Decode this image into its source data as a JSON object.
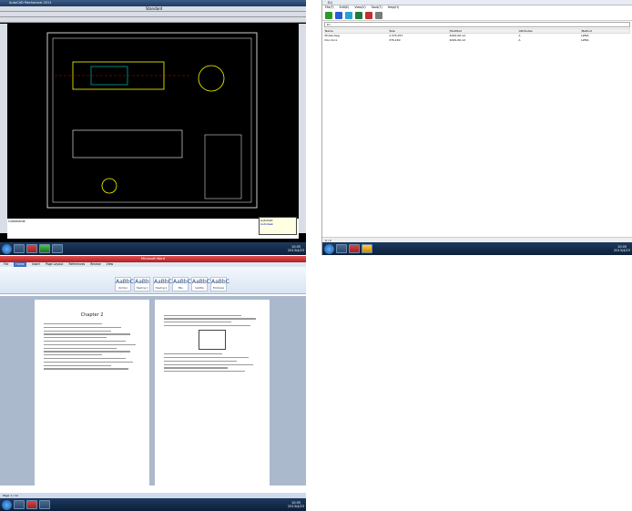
{
  "cad": {
    "title_left": "AutoCAD",
    "title_right": "Mechanical 2011",
    "layer": "Standard",
    "command_line": "Command:",
    "balloon_title": "AutoCAD",
    "balloon_link": "Autodesk"
  },
  "file_manager": {
    "title": "D:\\",
    "menu": [
      "File(F)",
      "Edit(E)",
      "View(V)",
      "Tools(T)",
      "Help(H)"
    ],
    "columns": [
      "Name",
      "Size",
      "Modified",
      "Attributes",
      "Method"
    ],
    "files": [
      {
        "name": "Model.dwg",
        "size": "1,375,257",
        "date": "2009-06-12",
        "attr": "A",
        "method": "LZMA"
      },
      {
        "name": "Doc.docx",
        "size": "376,160",
        "date": "2009-06-12",
        "attr": "A",
        "method": "LZMA"
      }
    ],
    "status": "0 / 2"
  },
  "word": {
    "title": "Microsoft Word",
    "tabs": [
      "File",
      "Home",
      "Insert",
      "Page Layout",
      "References",
      "Review",
      "View"
    ],
    "styles": [
      {
        "sample": "AaBbC",
        "name": "Normal"
      },
      {
        "sample": "AaBb",
        "name": "Heading 1"
      },
      {
        "sample": "AaBbC",
        "name": "Heading 2"
      },
      {
        "sample": "AaBbC",
        "name": "Title"
      },
      {
        "sample": "AaBbC",
        "name": "Subtitle"
      },
      {
        "sample": "AaBbC",
        "name": "Emphasis"
      }
    ],
    "page1_heading": "Chapter 2",
    "status": "Page 1 / 12"
  },
  "taskbar": {
    "time": "10:05",
    "date": "2013/4/23"
  },
  "colors": {
    "cad_bg": "#000000",
    "word_accent": "#b02020",
    "taskbar": "#0b1f38"
  }
}
